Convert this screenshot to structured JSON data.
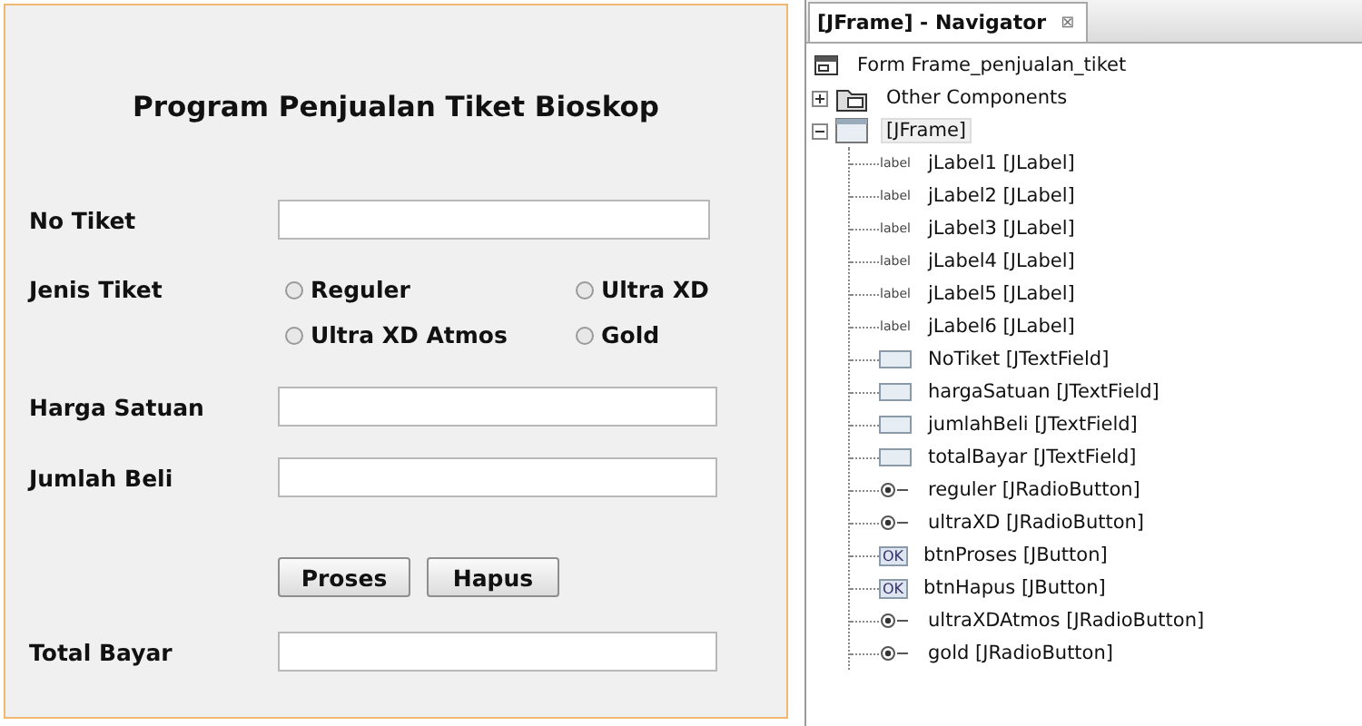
{
  "form": {
    "title": "Program Penjualan Tiket Bioskop",
    "rows": [
      {
        "kind": "text",
        "label": "No Tiket",
        "value": ""
      },
      {
        "kind": "radio",
        "label": "Jenis Tiket",
        "options": [
          {
            "label": "Reguler",
            "selected": false
          },
          {
            "label": "Ultra XD",
            "selected": false
          },
          {
            "label": "Ultra XD Atmos",
            "selected": false
          },
          {
            "label": "Gold",
            "selected": false
          }
        ]
      },
      {
        "kind": "text",
        "label": "Harga Satuan",
        "value": ""
      },
      {
        "kind": "text",
        "label": "Jumlah Beli",
        "value": ""
      },
      {
        "kind": "buttons",
        "buttons": [
          "Proses",
          "Hapus"
        ]
      },
      {
        "kind": "text",
        "label": "Total Bayar",
        "value": ""
      }
    ]
  },
  "navigator": {
    "title": "[JFrame] - Navigator",
    "close": "⊠",
    "tree": [
      {
        "kind": "form",
        "label": "Form Frame_penjualan_tiket",
        "selected": false,
        "children": [
          {
            "kind": "folder",
            "label": "Other Components",
            "expanded": false,
            "selected": false
          },
          {
            "kind": "frame",
            "label": "[JFrame]",
            "expanded": true,
            "selected": true,
            "children": [
              {
                "kind": "label",
                "icon_text": "label",
                "label": "jLabel1 [JLabel]",
                "selected": false
              },
              {
                "kind": "label",
                "icon_text": "label",
                "label": "jLabel2 [JLabel]",
                "selected": false
              },
              {
                "kind": "label",
                "icon_text": "label",
                "label": "jLabel3 [JLabel]",
                "selected": false
              },
              {
                "kind": "label",
                "icon_text": "label",
                "label": "jLabel4 [JLabel]",
                "selected": false
              },
              {
                "kind": "label",
                "icon_text": "label",
                "label": "jLabel5 [JLabel]",
                "selected": false
              },
              {
                "kind": "label",
                "icon_text": "label",
                "label": "jLabel6 [JLabel]",
                "selected": false
              },
              {
                "kind": "textfield",
                "label": "NoTiket [JTextField]",
                "selected": false
              },
              {
                "kind": "textfield",
                "label": "hargaSatuan [JTextField]",
                "selected": false
              },
              {
                "kind": "textfield",
                "label": "jumlahBeli [JTextField]",
                "selected": false
              },
              {
                "kind": "textfield",
                "label": "totalBayar [JTextField]",
                "selected": false
              },
              {
                "kind": "radio",
                "label": "reguler [JRadioButton]",
                "selected": false
              },
              {
                "kind": "radio",
                "label": "ultraXD [JRadioButton]",
                "selected": false
              },
              {
                "kind": "button",
                "icon_text": "OK",
                "label": "btnProses [JButton]",
                "selected": false
              },
              {
                "kind": "button",
                "icon_text": "OK",
                "label": "btnHapus [JButton]",
                "selected": false
              },
              {
                "kind": "radio",
                "label": "ultraXDAtmos [JRadioButton]",
                "selected": false
              },
              {
                "kind": "radio",
                "label": "gold [JRadioButton]",
                "selected": false
              }
            ]
          }
        ]
      }
    ]
  }
}
